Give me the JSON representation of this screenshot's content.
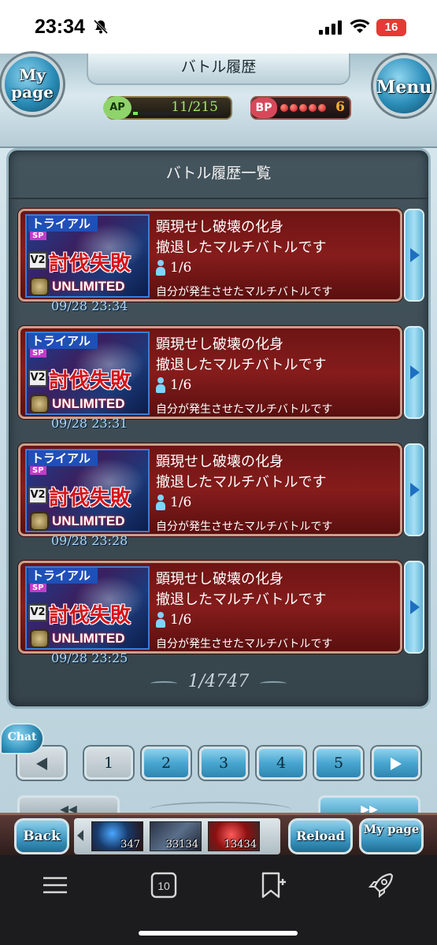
{
  "status_bar": {
    "time": "23:34",
    "battery": "16"
  },
  "header": {
    "mypage_label": "My page",
    "title": "バトル履歴",
    "menu_label": "Menu",
    "ap_label": "AP",
    "ap_value": "11/215",
    "ap_fraction": 0.051,
    "bp_label": "BP",
    "bp_value": "6"
  },
  "panel": {
    "title": "バトル履歴一覧",
    "entries": [
      {
        "tag": "トライアル",
        "sp": "SP",
        "v2": "V2",
        "result": "討伐失敗",
        "mode": "UNLIMITED",
        "title": "顕現せし破壊の化身",
        "message": "撤退したマルチバトルです",
        "players": "1/6",
        "note": "自分が発生させたマルチバトルです",
        "date": "09/28 23:34"
      },
      {
        "tag": "トライアル",
        "sp": "SP",
        "v2": "V2",
        "result": "討伐失敗",
        "mode": "UNLIMITED",
        "title": "顕現せし破壊の化身",
        "message": "撤退したマルチバトルです",
        "players": "1/6",
        "note": "自分が発生させたマルチバトルです",
        "date": "09/28 23:31"
      },
      {
        "tag": "トライアル",
        "sp": "SP",
        "v2": "V2",
        "result": "討伐失敗",
        "mode": "UNLIMITED",
        "title": "顕現せし破壊の化身",
        "message": "撤退したマルチバトルです",
        "players": "1/6",
        "note": "自分が発生させたマルチバトルです",
        "date": "09/28 23:28"
      },
      {
        "tag": "トライアル",
        "sp": "SP",
        "v2": "V2",
        "result": "討伐失敗",
        "mode": "UNLIMITED",
        "title": "顕現せし破壊の化身",
        "message": "撤退したマルチバトルです",
        "players": "1/6",
        "note": "自分が発生させたマルチバトルです",
        "date": "09/28 23:25"
      }
    ],
    "page_indicator": "1/4747"
  },
  "pagination": {
    "chat_label": "Chat",
    "pages": [
      "1",
      "2",
      "3",
      "4",
      "5"
    ],
    "first_symbol": "◀◀",
    "last_symbol": "▶▶"
  },
  "footer": {
    "back_label": "Back",
    "reload_label": "Reload",
    "mypage_label": "My page",
    "items": [
      "347",
      "33134",
      "13434"
    ]
  },
  "browser_toolbar": {
    "tabs_count": "10"
  },
  "colors": {
    "card_red": "#861c1c",
    "accent_blue": "#3c97c2",
    "date_blue": "#a9d7ff"
  }
}
